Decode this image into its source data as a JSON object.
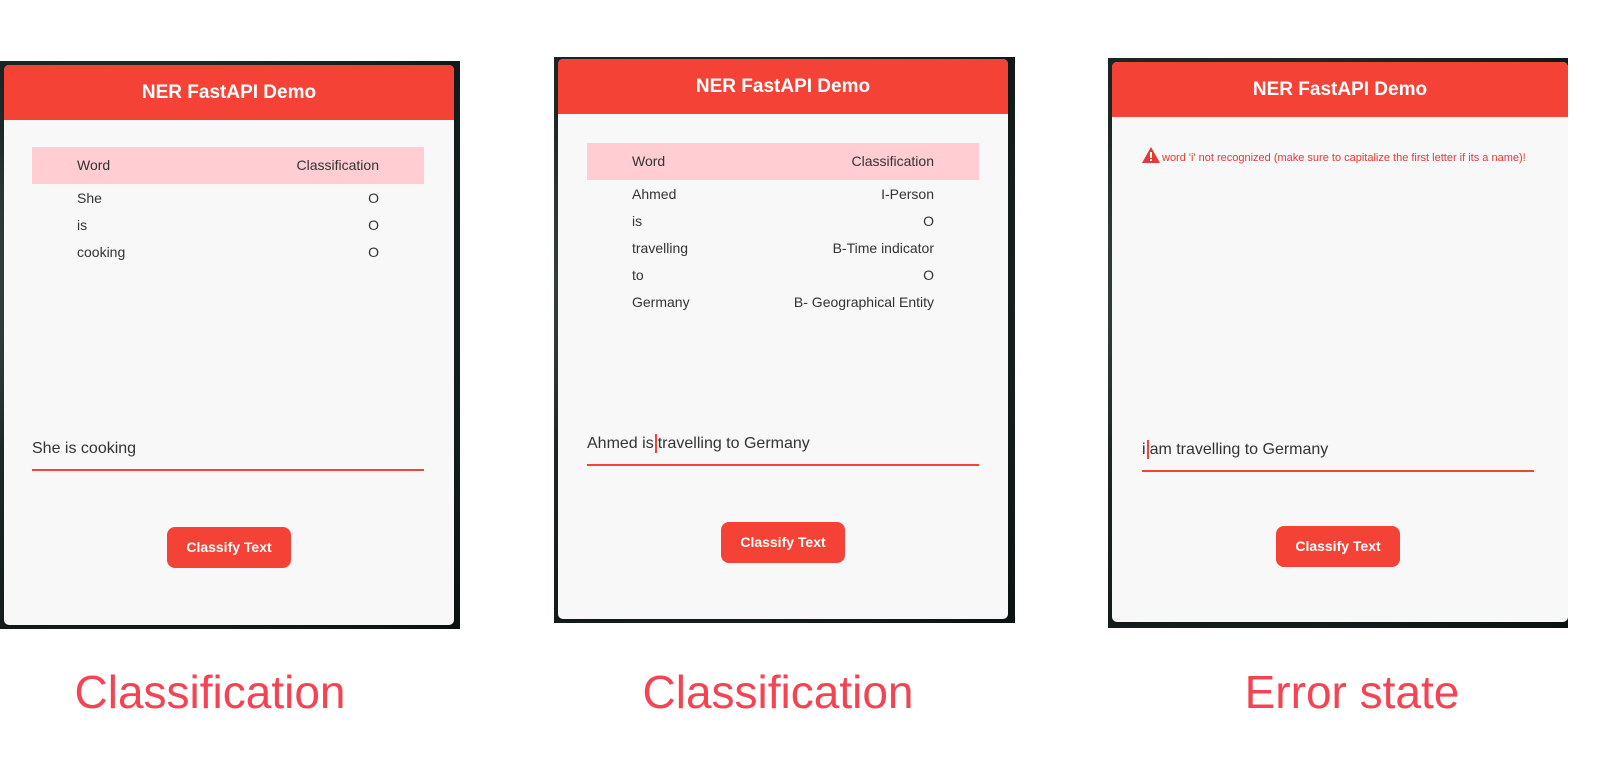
{
  "screens": [
    {
      "app_title": "NER FastAPI Demo",
      "table": {
        "headers": [
          "Word",
          "Classification"
        ],
        "rows": [
          [
            "She",
            "O"
          ],
          [
            "is",
            "O"
          ],
          [
            "cooking",
            "O"
          ]
        ]
      },
      "input_value": "She is cooking",
      "button_label": "Classify Text",
      "caption": "Classification"
    },
    {
      "app_title": "NER FastAPI Demo",
      "table": {
        "headers": [
          "Word",
          "Classification"
        ],
        "rows": [
          [
            "Ahmed",
            "I-Person"
          ],
          [
            "is",
            "O"
          ],
          [
            "travelling",
            "B-Time indicator"
          ],
          [
            "to",
            "O"
          ],
          [
            "Germany",
            "B- Geographical Entity"
          ]
        ]
      },
      "input_value_before_caret": "Ahmed is",
      "input_value_after_caret": "travelling to Germany",
      "button_label": "Classify Text",
      "caption": "Classification"
    },
    {
      "app_title": "NER FastAPI Demo",
      "error_message": "word 'i' not recognized (make sure to capitalize the first letter if its a name)!",
      "error_icon": "warning-icon",
      "input_value_before_caret": "i",
      "input_value_after_caret": "am travelling to Germany",
      "button_label": "Classify Text",
      "caption": "Error state"
    }
  ],
  "colors": {
    "accent": "#f44336",
    "table_header": "#ffcdd2",
    "caption": "#f44352"
  }
}
